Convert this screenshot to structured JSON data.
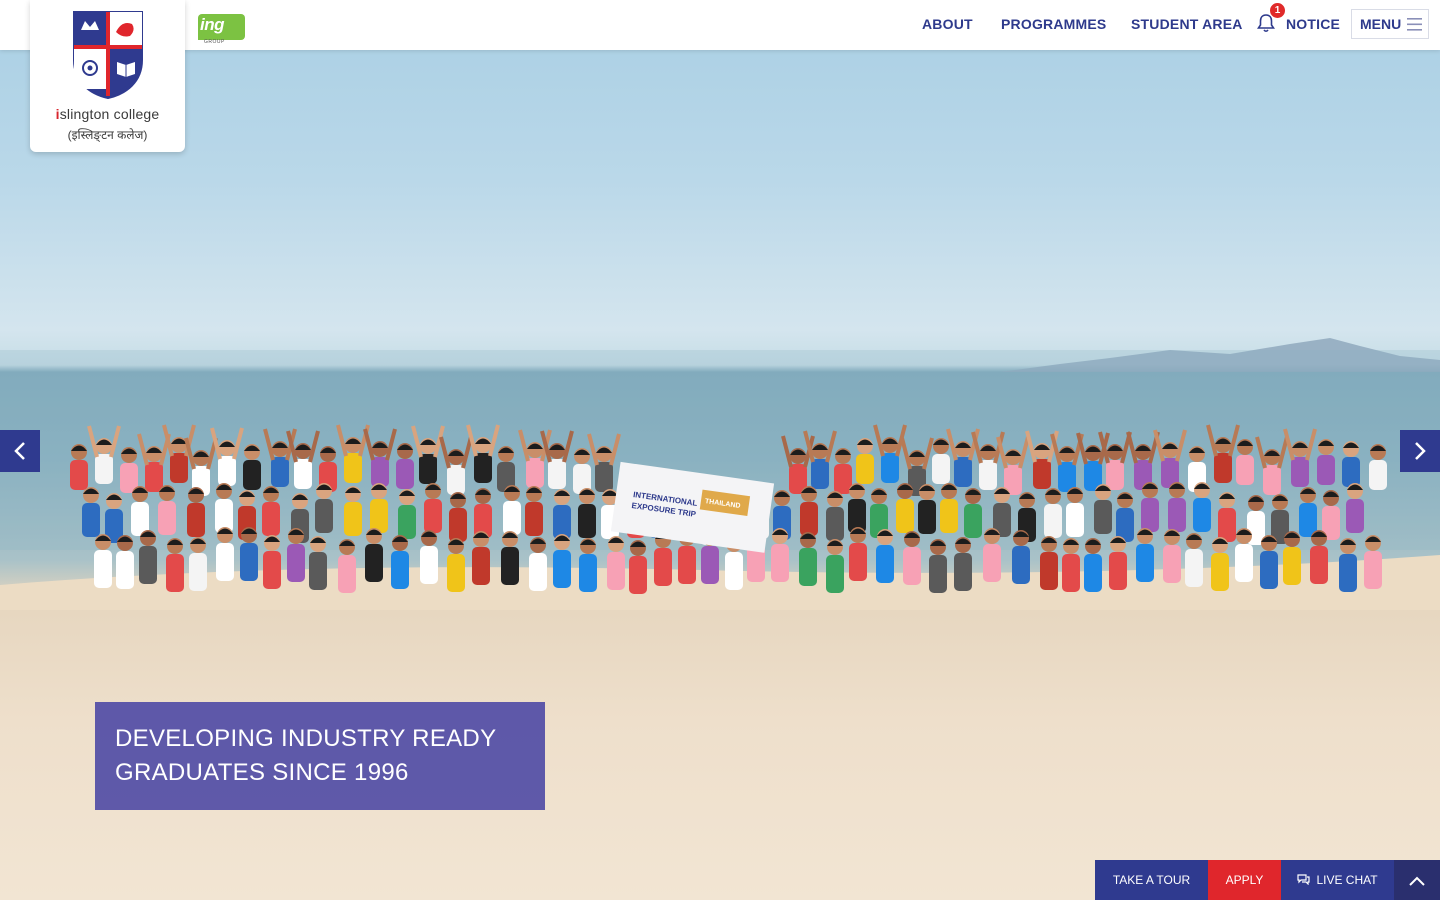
{
  "logo": {
    "name_prefix": "i",
    "name_rest": "slington college",
    "subtitle": "(इस्लिङ्टन कलेज)"
  },
  "group_logo": {
    "text": "ing",
    "label": "GROUP"
  },
  "nav": {
    "about": "ABOUT",
    "programmes": "PROGRAMMES",
    "student_area": "STUDENT AREA",
    "notice": "NOTICE",
    "notice_count": "1",
    "menu": "MENU"
  },
  "hero": {
    "banner_text_1": "INTERNATIONAL",
    "banner_text_2": "EXPOSURE TRIP",
    "banner_text_3": "THAILAND",
    "caption_line1": "DEVELOPING INDUSTRY READY",
    "caption_line2": "GRADUATES SINCE 1996"
  },
  "actions": {
    "tour": "TAKE A TOUR",
    "apply": "APPLY",
    "chat": "LIVE CHAT"
  },
  "colors": {
    "navy": "#2f3a8f",
    "nav_text": "#2e3a8c",
    "apply_red": "#e0262c",
    "caption_bg": "#4a46a4",
    "ing_green": "#7cc242"
  },
  "icons": [
    "bell-icon",
    "hamburger-icon",
    "chevron-left-icon",
    "chevron-right-icon",
    "chat-bubble-icon",
    "chevron-up-icon"
  ]
}
